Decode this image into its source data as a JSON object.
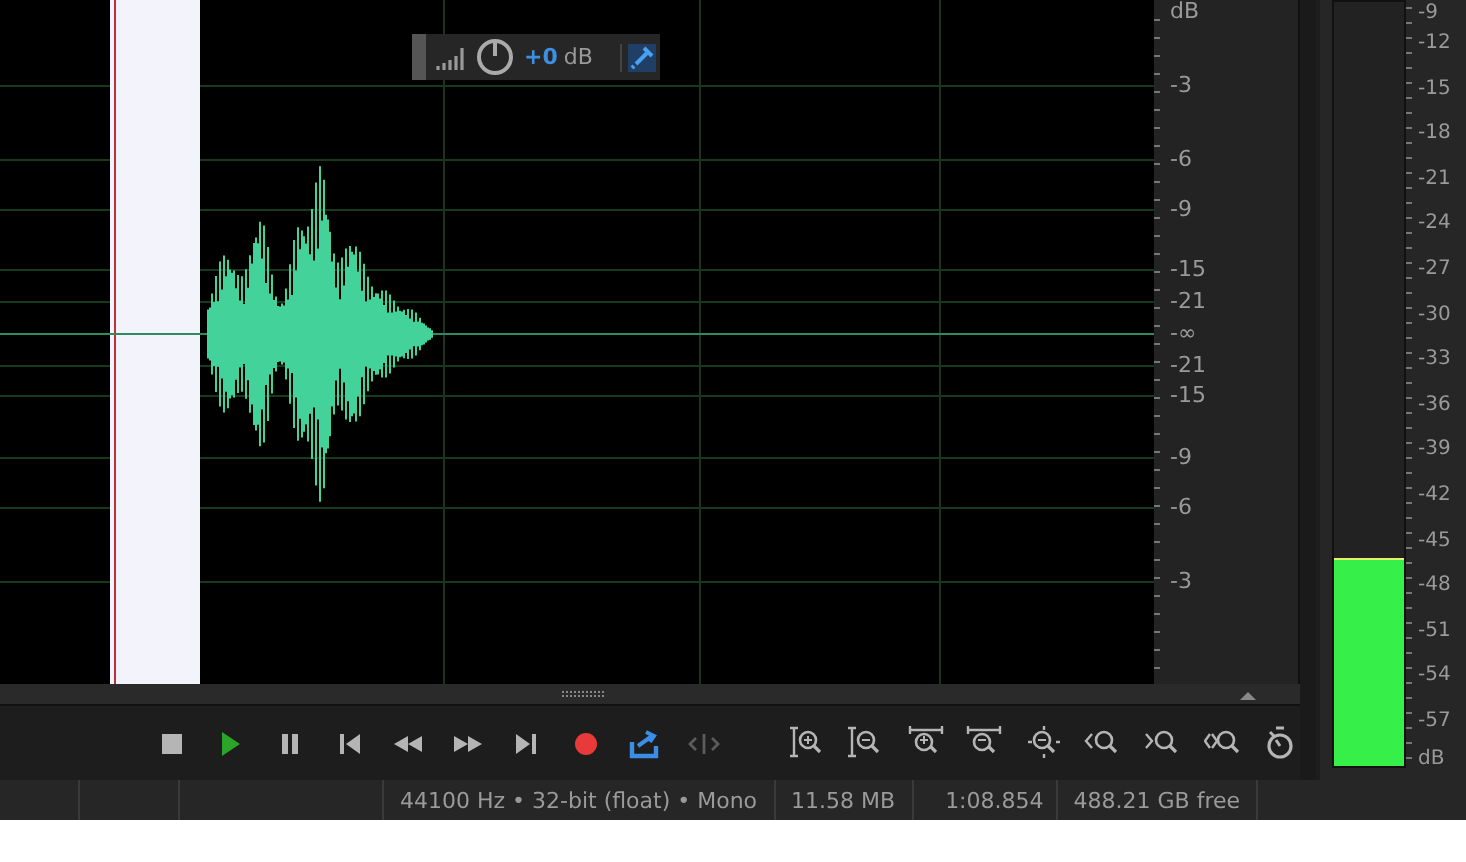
{
  "waveform": {
    "hud": {
      "value": "+0",
      "unit": "dB"
    }
  },
  "amplitude_ruler": {
    "labels": [
      "dB",
      "-3",
      "-6",
      "-9",
      "-15",
      "-21",
      "-∞",
      "-21",
      "-15",
      "-9",
      "-6",
      "-3"
    ]
  },
  "level_meter": {
    "level": 0.27,
    "labels": [
      "-9",
      "-12",
      "-15",
      "-18",
      "-21",
      "-24",
      "-27",
      "-30",
      "-33",
      "-36",
      "-39",
      "-42",
      "-45",
      "-48",
      "-51",
      "-54",
      "-57",
      "dB"
    ]
  },
  "transport": [
    {
      "kind": "stop",
      "disabled": false
    },
    {
      "kind": "play",
      "disabled": false
    },
    {
      "kind": "pause",
      "disabled": false
    },
    {
      "kind": "start",
      "disabled": false
    },
    {
      "kind": "rewind",
      "disabled": false
    },
    {
      "kind": "forward",
      "disabled": false
    },
    {
      "kind": "end",
      "disabled": false
    },
    {
      "kind": "record",
      "disabled": false
    },
    {
      "kind": "loop",
      "disabled": false
    },
    {
      "kind": "skip",
      "disabled": true
    }
  ],
  "zoom_tools": [
    {
      "kind": "in-amplitude"
    },
    {
      "kind": "out-amplitude"
    },
    {
      "kind": "in-time"
    },
    {
      "kind": "out-time"
    },
    {
      "kind": "selection"
    },
    {
      "kind": "in-point"
    },
    {
      "kind": "out-point"
    },
    {
      "kind": "both-points"
    },
    {
      "kind": "timer"
    }
  ],
  "status_bar": {
    "format": "44100 Hz • 32-bit (float) • Mono",
    "file_size": "11.58 MB",
    "duration": "1:08.854",
    "free_space": "488.21 GB free"
  }
}
